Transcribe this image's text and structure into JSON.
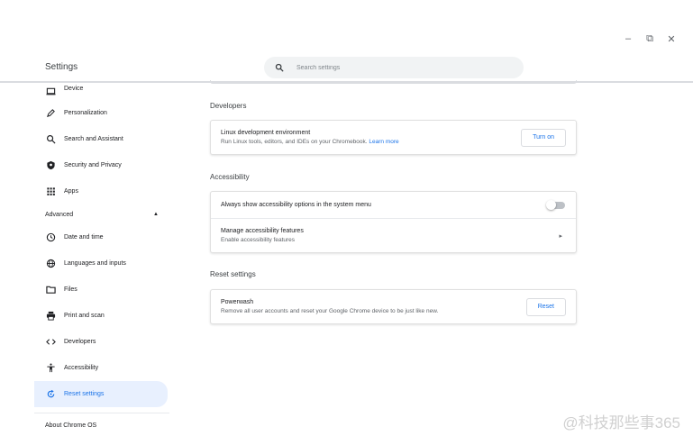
{
  "window_controls": {
    "minimize": "–",
    "restore": "⧉",
    "close": "✕"
  },
  "header": {
    "title": "Settings",
    "search_placeholder": "Search settings"
  },
  "sidebar": {
    "items_top": [
      {
        "label": "Device",
        "icon": "laptop-icon"
      },
      {
        "label": "Personalization",
        "icon": "pen-icon"
      },
      {
        "label": "Search and Assistant",
        "icon": "search-icon"
      },
      {
        "label": "Security and Privacy",
        "icon": "shield-icon"
      },
      {
        "label": "Apps",
        "icon": "apps-grid-icon"
      }
    ],
    "advanced_label": "Advanced",
    "items_advanced": [
      {
        "label": "Date and time",
        "icon": "clock-icon"
      },
      {
        "label": "Languages and inputs",
        "icon": "globe-icon"
      },
      {
        "label": "Files",
        "icon": "folder-icon"
      },
      {
        "label": "Print and scan",
        "icon": "printer-icon"
      },
      {
        "label": "Developers",
        "icon": "code-icon"
      },
      {
        "label": "Accessibility",
        "icon": "accessibility-icon"
      },
      {
        "label": "Reset settings",
        "icon": "reset-icon",
        "active": true
      }
    ],
    "about_label": "About Chrome OS"
  },
  "main": {
    "developers": {
      "title": "Developers",
      "linux_title": "Linux development environment",
      "linux_sub": "Run Linux tools, editors, and IDEs on your Chromebook.",
      "linux_link": "Learn more",
      "turn_on_label": "Turn on"
    },
    "accessibility": {
      "title": "Accessibility",
      "always_show_label": "Always show accessibility options in the system menu",
      "always_show_enabled": false,
      "manage_title": "Manage accessibility features",
      "manage_sub": "Enable accessibility features"
    },
    "reset": {
      "title": "Reset settings",
      "powerwash_title": "Powerwash",
      "powerwash_sub": "Remove all user accounts and reset your Google Chrome device to be just like new.",
      "reset_label": "Reset"
    }
  },
  "watermark": "@科技那些事365",
  "colors": {
    "accent": "#1a73e8",
    "active_bg": "#e8f0fe",
    "border": "#dadce0"
  }
}
